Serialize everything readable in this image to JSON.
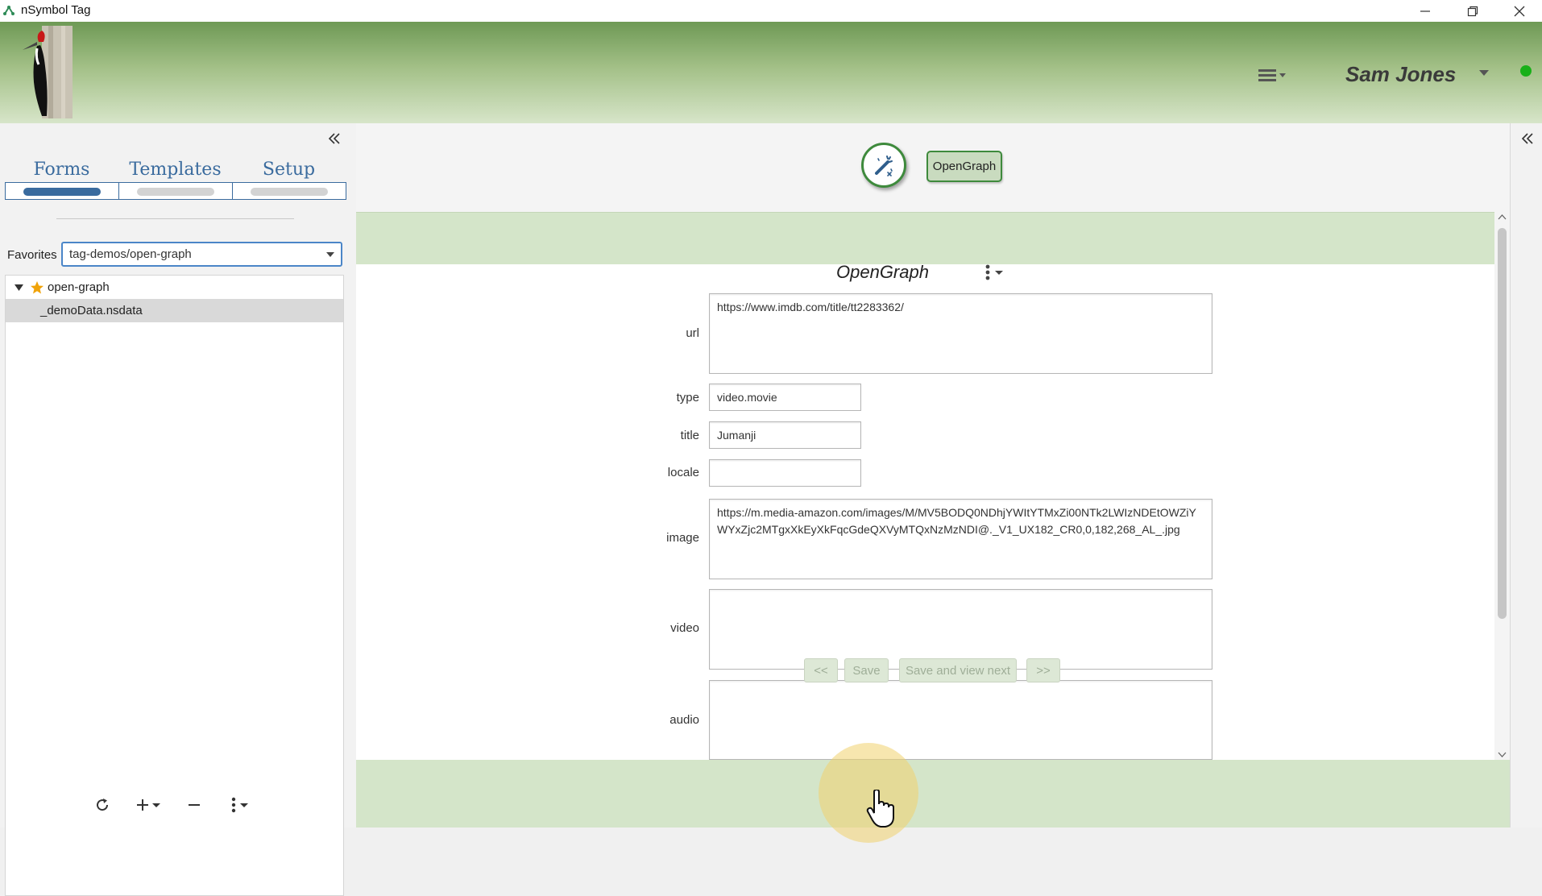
{
  "window": {
    "title": "nSymbol Tag"
  },
  "header": {
    "user_name": "Sam Jones",
    "status_color": "#19b019"
  },
  "left_panel": {
    "tabs": [
      {
        "label": "Forms",
        "active": true
      },
      {
        "label": "Templates",
        "active": false
      },
      {
        "label": "Setup",
        "active": false
      }
    ],
    "favorites_label": "Favorites",
    "favorites_value": "tag-demos/open-graph",
    "tree": [
      {
        "label": "open-graph",
        "expanded": true,
        "starred": true
      },
      {
        "label": "_demoData.nsdata",
        "selected": true
      }
    ]
  },
  "main": {
    "template_chip": "OpenGraph",
    "form_title": "OpenGraph",
    "fields": [
      {
        "label": "url",
        "value": "https://www.imdb.com/title/tt2283362/"
      },
      {
        "label": "type",
        "value": "video.movie"
      },
      {
        "label": "title",
        "value": "Jumanji"
      },
      {
        "label": "locale",
        "value": ""
      },
      {
        "label": "image",
        "value": "https://m.media-amazon.com/images/M/MV5BODQ0NDhjYWItYTMxZi00NTk2LWIzNDEtOWZiYWYxZjc2MTgxXkEyXkFqcGdeQXVyMTQxNzMzNDI@._V1_UX182_CR0,0,182,268_AL_.jpg"
      },
      {
        "label": "video",
        "value": ""
      },
      {
        "label": "audio",
        "value": ""
      }
    ],
    "footer": {
      "prev_label": "<<",
      "save_label": "Save",
      "save_next_label": "Save and view next",
      "next_label": ">>"
    }
  },
  "colors": {
    "accent": "#3e8a3c",
    "tab_blue": "#3a6b9e",
    "form_band": "#d4e5c9"
  }
}
